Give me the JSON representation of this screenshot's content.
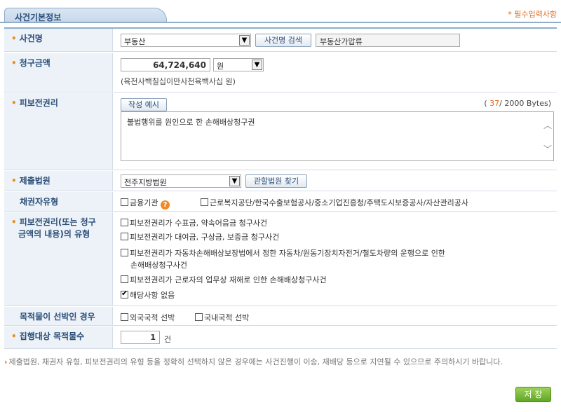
{
  "header": {
    "tab_title": "사건기본정보",
    "required_note": "* 필수입력사항"
  },
  "fields": {
    "case_name": {
      "label": "사건명",
      "select_value": "부동산",
      "search_button": "사건명 검색",
      "result_value": "부동산가압류"
    },
    "claim_amount": {
      "label": "청구금액",
      "amount": "64,724,640",
      "unit": "원",
      "korean_amount": "(육천사백칠십이만사천육백사십 원)"
    },
    "preserved_right": {
      "label": "피보전권리",
      "example_button": "작성 예시",
      "byte_count": "37",
      "byte_limit": "/ 2000 Bytes)",
      "byte_open": "(",
      "text": "불법행위를 원인으로 한 손해배상청구권"
    },
    "court": {
      "label": "제출법원",
      "select_value": "전주지방법원",
      "find_button": "관할법원 찾기"
    },
    "creditor_type": {
      "label": "채권자유형",
      "options": [
        {
          "label": "금융기관",
          "checked": false
        },
        {
          "label": "근로복지공단/한국수출보험공사/중소기업진흥청/주택도시보증공사/자산관리공사",
          "checked": false
        }
      ]
    },
    "right_type": {
      "label_line1": "피보전권리(또는 청구",
      "label_line2": "금액의 내용)의 유형",
      "options": [
        {
          "label": "피보전권리가 수표금, 약속어음금 청구사건",
          "checked": false
        },
        {
          "label": "피보전권리가 대여금, 구상금, 보증금 청구사건",
          "checked": false
        },
        {
          "label": "피보전권리가 자동차손해배상보장법에서 정한 자동차/원동기장치자전거/철도차량의 운행으로 인한",
          "checked": false,
          "cont": "손해배상청구사건"
        },
        {
          "label": "피보전권리가 근로자의 업무상 재해로 인한 손해배상청구사건",
          "checked": false
        },
        {
          "label": "해당사항 없음",
          "checked": true
        }
      ]
    },
    "vessel": {
      "label": "목적물이 선박인 경우",
      "options": [
        {
          "label": "외국국적 선박",
          "checked": false
        },
        {
          "label": "국내국적 선박",
          "checked": false
        }
      ]
    },
    "target_count": {
      "label": "집행대상 목적물수",
      "value": "1",
      "unit": "건"
    }
  },
  "notice": {
    "marker": "›",
    "text": "제출법원, 채권자 유형, 피보전권리의 유형 등을 정확히 선택하지 않은 경우에는 사건진행이 이송, 재배당 등으로 지연될 수 있으므로 주의하시기 바랍니다."
  },
  "save_button": "저 장",
  "colors": {
    "accent": "#2b4e78",
    "required": "#e06a1b",
    "save": "#6db12c"
  }
}
